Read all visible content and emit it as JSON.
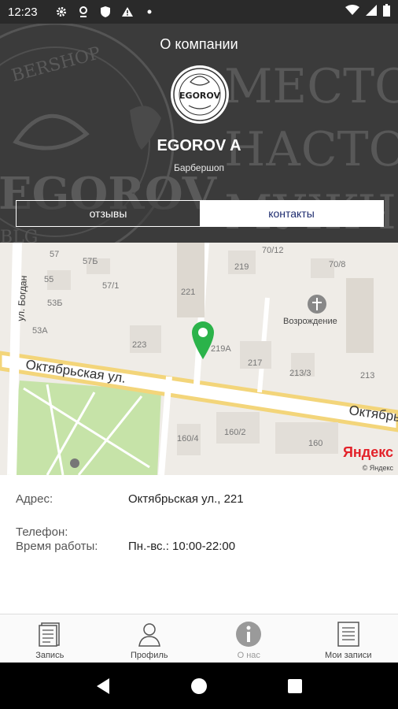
{
  "status_bar": {
    "time": "12:23",
    "icons": [
      "gear-icon",
      "location-icon",
      "shield-icon",
      "warning-icon",
      "dot-icon"
    ],
    "right_icons": [
      "wifi-icon",
      "signal-icon",
      "battery-icon"
    ]
  },
  "header": {
    "title": "О компании",
    "company_name": "EGOROV A",
    "subtitle": "Барбершоп",
    "logo_text": "EGOROV",
    "background_words": [
      "МЕСТО",
      "НАСТОЯ",
      "МУЖЧИН"
    ],
    "background_brand": "EGOROV",
    "background_arc_text": "BERSHOP",
    "background_small": "BLG"
  },
  "tabs": [
    {
      "label": "отзывы",
      "active": false
    },
    {
      "label": "контакты",
      "active": true
    }
  ],
  "map": {
    "street_main": "Октябрьская ул.",
    "street_main_right": "Октябрь",
    "street_side": "ул. Богдан",
    "place_label": "Возрождение",
    "house_numbers": [
      "57",
      "57Б",
      "55",
      "57/1",
      "53Б",
      "53А",
      "223",
      "221",
      "219",
      "70/12",
      "70/8",
      "219А",
      "217",
      "213/3",
      "213",
      "160/4",
      "160/2",
      "160"
    ],
    "provider": "Яндекс",
    "provider_sub": "© Яндекс",
    "pin_color": "#2bb34a"
  },
  "contact": {
    "address_label": "Адрес:",
    "address_value": "Октябрьская ул., 221",
    "phone_label": "Телефон:",
    "phone_value": "",
    "hours_label": "Время работы:",
    "hours_value": "Пн.-вс.: 10:00-22:00"
  },
  "bottom_nav": [
    {
      "label": "Запись",
      "icon": "document-icon",
      "active": false
    },
    {
      "label": "Профиль",
      "icon": "person-icon",
      "active": false
    },
    {
      "label": "О нас",
      "icon": "info-icon",
      "active": true
    },
    {
      "label": "Мои записи",
      "icon": "list-icon",
      "active": false
    }
  ],
  "colors": {
    "header_bg": "#3a3a3a",
    "tab_active_text": "#1d2b6e",
    "status_bar_bg": "#2a2a2a"
  }
}
